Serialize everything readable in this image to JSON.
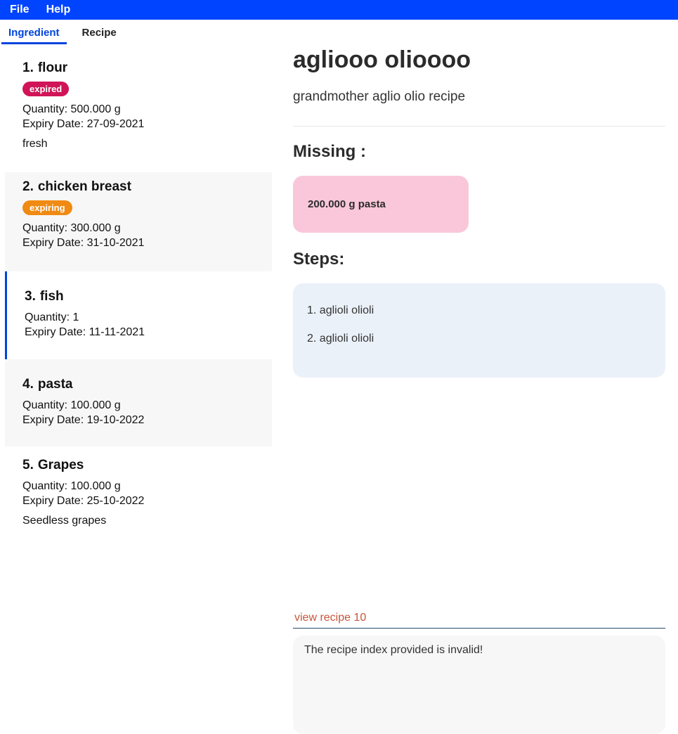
{
  "menu": {
    "file": "File",
    "help": "Help"
  },
  "tabs": {
    "ingredient": "Ingredient",
    "recipe": "Recipe"
  },
  "colors": {
    "accent": "#0044ff",
    "expired": "#d01457",
    "expiring": "#f08a12",
    "missing_bg": "#f9c7d9",
    "steps_bg": "#ebf1f9"
  },
  "ingredients": [
    {
      "num": "1.",
      "name": "flour",
      "badge": "expired",
      "quantity": "Quantity: 500.000 g",
      "expiry": "Expiry Date: 27-09-2021",
      "desc": "fresh"
    },
    {
      "num": "2.",
      "name": "chicken breast",
      "badge": "expiring",
      "quantity": "Quantity: 300.000 g",
      "expiry": "Expiry Date: 31-10-2021"
    },
    {
      "num": "3.",
      "name": "fish",
      "quantity": "Quantity: 1",
      "expiry": "Expiry Date: 11-11-2021"
    },
    {
      "num": "4.",
      "name": "pasta",
      "quantity": "Quantity: 100.000 g",
      "expiry": "Expiry Date: 19-10-2022"
    },
    {
      "num": "5.",
      "name": "Grapes",
      "quantity": "Quantity: 100.000 g",
      "expiry": "Expiry Date: 25-10-2022",
      "desc": "Seedless grapes"
    }
  ],
  "recipe": {
    "title": "agliooo olioooo",
    "description": "grandmother aglio olio recipe",
    "missing_label": "Missing :",
    "missing_items": [
      "200.000 g pasta"
    ],
    "steps_label": "Steps:",
    "steps": [
      "1. aglioli olioli",
      "2. aglioli olioli"
    ]
  },
  "command": {
    "value": "view recipe 10"
  },
  "result": {
    "message": "The recipe index provided is invalid!"
  }
}
